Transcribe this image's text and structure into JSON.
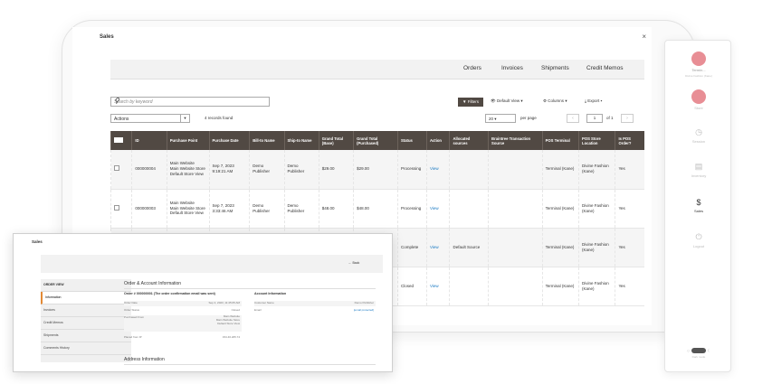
{
  "panel": {
    "title": "Sales",
    "close": "×",
    "nav": [
      "Orders",
      "Invoices",
      "Shipments",
      "Credit Memos"
    ],
    "search_placeholder": "Search by keyword",
    "search_icon": "search-icon",
    "filters": "Filters",
    "default_view": "Default View",
    "columns": "Columns",
    "export": "Export",
    "actions": "Actions",
    "records_found": "4 records found",
    "per_page_value": "20",
    "per_page_label": "per page",
    "page_current": "1",
    "page_of": "of 1",
    "columns_list": [
      "ID",
      "Purchase Point",
      "Purchase Date",
      "Bill-to Name",
      "Ship-to Name",
      "Grand Total (Base)",
      "Grand Total (Purchased)",
      "Status",
      "Action",
      "Allocated sources",
      "Braintree Transaction Source",
      "POS Terminal",
      "POS Store Location",
      "Is POS Order?"
    ],
    "rows": [
      {
        "id": "000000004",
        "point": "Main Website\nMain Website Store\nDefault Store View",
        "date": "Sep 7, 2023\n9:19:21 AM",
        "bill": "Demo Publisher",
        "ship": "Demo Publisher",
        "base": "$29.00",
        "purch": "$29.00",
        "status": "Processing",
        "action": "View",
        "alloc": "",
        "bt": "",
        "term": "Terminal (Kane)",
        "loc": "Divine Fashion (Kane)",
        "pos": "Yes"
      },
      {
        "id": "000000003",
        "point": "Main Website\nMain Website Store\nDefault Store View",
        "date": "Sep 7, 2023\n3:33:46 AM",
        "bill": "Demo Publisher",
        "ship": "Demo Publisher",
        "base": "$48.00",
        "purch": "$48.00",
        "status": "Processing",
        "action": "View",
        "alloc": "",
        "bt": "",
        "term": "Terminal (Kane)",
        "loc": "Divine Fashion (Kane)",
        "pos": "Yes"
      },
      {
        "id": "",
        "point": "",
        "date": "",
        "bill": "",
        "ship": "",
        "base": "",
        "purch": "",
        "status": "Complete",
        "action": "View",
        "alloc": "Default Source",
        "bt": "",
        "term": "Terminal (Kane)",
        "loc": "Divine Fashion (Kane)",
        "pos": "Yes"
      },
      {
        "id": "",
        "point": "",
        "date": "",
        "bill": "",
        "ship": "",
        "base": "",
        "purch": "",
        "status": "Closed",
        "action": "View",
        "alloc": "",
        "bt": "",
        "term": "Terminal (Kane)",
        "loc": "Divine Fashion (Kane)",
        "pos": "Yes"
      }
    ]
  },
  "sidebar": {
    "items": [
      {
        "label": "Termin...",
        "sub": "Divine Fashion (Kane)"
      },
      {
        "label": "Store"
      },
      {
        "label": "Session"
      },
      {
        "label": "Inventory"
      },
      {
        "label": "Sales",
        "icon": "$"
      },
      {
        "label": "Logout"
      }
    ],
    "theme_label": "Dark mode"
  },
  "overlay": {
    "title": "Sales",
    "back": "← Back",
    "side_items": [
      "ORDER VIEW",
      "Information",
      "Invoices",
      "Credit Memos",
      "Shipments",
      "Comments History"
    ],
    "section": "Order & Account Information",
    "order_heading": "Order # 000000001 (The order confirmation email was sent)",
    "account_heading": "Account Information",
    "order_rows": [
      {
        "k": "Order Date",
        "v": "Sep 4, 2023, 11:45:05 AM"
      },
      {
        "k": "Order Status",
        "v": "Closed"
      },
      {
        "k": "Purchased From",
        "v": "Main Website\nMain Website Store\nDefault Store View"
      },
      {
        "k": "Placed from IP",
        "v": "154.46.205.74"
      }
    ],
    "account_rows": [
      {
        "k": "Customer Name",
        "v": "Demo Publisher"
      },
      {
        "k": "Email",
        "v": "[email protected]"
      }
    ],
    "address_heading": "Address Information"
  }
}
